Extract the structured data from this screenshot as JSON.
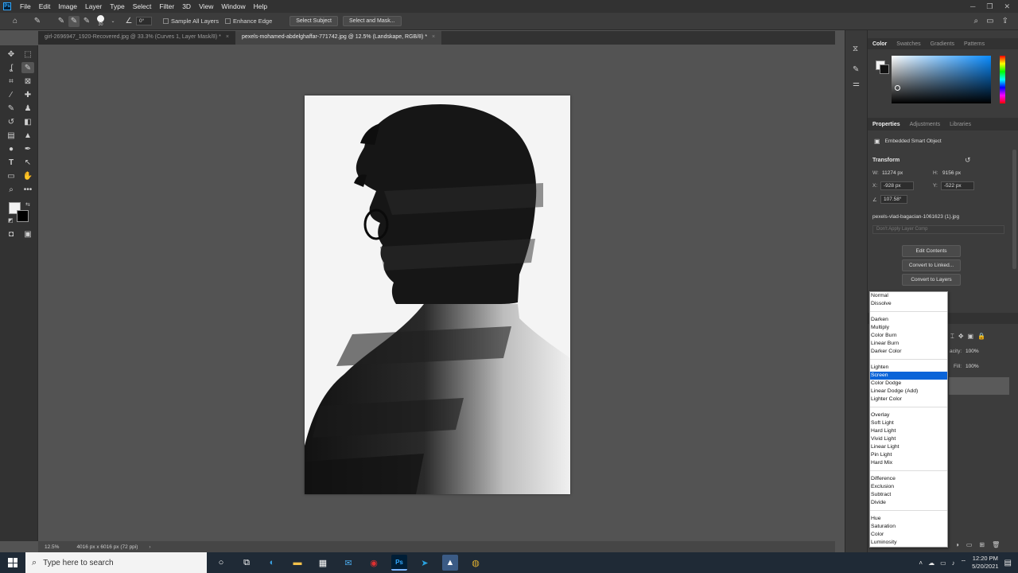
{
  "menubar": {
    "logo": "Ps",
    "items": [
      "File",
      "Edit",
      "Image",
      "Layer",
      "Type",
      "Select",
      "Filter",
      "3D",
      "View",
      "Window",
      "Help"
    ]
  },
  "options": {
    "brush_size": "30",
    "angle": "0°",
    "sample_all_layers": "Sample All Layers",
    "enhance_edge": "Enhance Edge",
    "select_subject": "Select Subject",
    "select_and_mask": "Select and Mask..."
  },
  "tabs": [
    {
      "label": "girl-2696947_1920-Recovered.jpg @ 33.3% (Curves 1, Layer Mask/8) *",
      "active": false
    },
    {
      "label": "pexels-mohamed-abdelghaffar-771742.jpg @ 12.5% (Landskape, RGB/8) *",
      "active": true
    }
  ],
  "statusbar": {
    "zoom": "12.5%",
    "doc_info": "4016 px x 6016 px (72 ppi)"
  },
  "color_panel": {
    "tabs": [
      "Color",
      "Swatches",
      "Gradients",
      "Patterns"
    ]
  },
  "properties_panel": {
    "tabs": [
      "Properties",
      "Adjustments",
      "Libraries"
    ],
    "object_type": "Embedded Smart Object",
    "section": "Transform",
    "w_label": "W:",
    "w_value": "11274 px",
    "h_label": "H:",
    "h_value": "9156 px",
    "x_label": "X:",
    "x_value": "-928 px",
    "y_label": "Y:",
    "y_value": "-522 px",
    "angle_value": "107.58°",
    "linked_file": "pexels-vlad-bagacian-1061623 (1).jpg",
    "layer_comp_placeholder": "Don't Apply Layer Comp",
    "edit_contents": "Edit Contents",
    "convert_linked": "Convert to Linked...",
    "convert_layers": "Convert to Layers"
  },
  "layers_peek": {
    "opacity_label": "acity:",
    "opacity_value": "100%",
    "fill_label": "Fill:",
    "fill_value": "100%"
  },
  "blend_modes": {
    "groups": [
      [
        "Normal",
        "Dissolve"
      ],
      [
        "Darken",
        "Multiply",
        "Color Burn",
        "Linear Burn",
        "Darker Color"
      ],
      [
        "Lighten",
        "Screen",
        "Color Dodge",
        "Linear Dodge (Add)",
        "Lighter Color"
      ],
      [
        "Overlay",
        "Soft Light",
        "Hard Light",
        "Vivid Light",
        "Linear Light",
        "Pin Light",
        "Hard Mix"
      ],
      [
        "Difference",
        "Exclusion",
        "Subtract",
        "Divide"
      ],
      [
        "Hue",
        "Saturation",
        "Color",
        "Luminosity"
      ]
    ],
    "selected": "Screen"
  },
  "taskbar": {
    "search_placeholder": "Type here to search",
    "time": "12:20 PM",
    "date": "5/20/2021"
  }
}
